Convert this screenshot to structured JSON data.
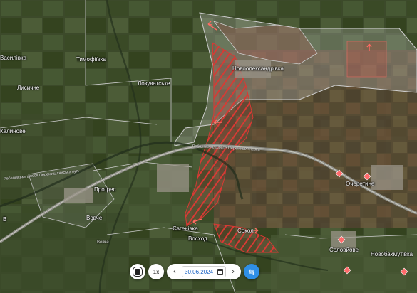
{
  "map": {
    "places": [
      {
        "id": "vasylivka",
        "label": "Василівка"
      },
      {
        "id": "tymofiivka",
        "label": "Тимофіївка"
      },
      {
        "id": "lysychne",
        "label": "Лисичне"
      },
      {
        "id": "lozuvatske",
        "label": "Лозуватське"
      },
      {
        "id": "novooleksandrivka",
        "label": "Новоолександрівка"
      },
      {
        "id": "sokil",
        "label": "Сокол"
      },
      {
        "id": "ocheretyne",
        "label": "Очеретине"
      },
      {
        "id": "prohres",
        "label": "Прогрес"
      },
      {
        "id": "vovche",
        "label": "Вовче"
      },
      {
        "id": "yevhenivka",
        "label": "Євгенівка"
      },
      {
        "id": "voskhod",
        "label": "Восход"
      },
      {
        "id": "solovyove",
        "label": "Соловйове"
      },
      {
        "id": "novobakhmutivka",
        "label": "Новобахмутівка"
      },
      {
        "id": "kalynove",
        "label": "Калинове"
      },
      {
        "id": "vovche2",
        "label": "Вовче"
      },
      {
        "id": "v-left",
        "label": "В"
      }
    ],
    "roads": [
      {
        "id": "road-left",
        "label": "Ребалівське шоссе Перемишлянська вул."
      },
      {
        "id": "road-right",
        "label": "Ребалівське шоссе Перемишлянська"
      }
    ],
    "colors": {
      "occupied_hatch": "#d83a34",
      "occupied_fill": "rgba(160,90,80,0.35)",
      "grey_zone": "rgba(200,200,200,0.30)",
      "boundary": "#cfcfcf",
      "attack_arrow": "#ff6a62",
      "marker": "#ff6b6b"
    }
  },
  "controls": {
    "play_icon": "record-icon",
    "speed_label": "1x",
    "date_prev_icon": "chevron-left-icon",
    "date_value": "30.06.2024",
    "date_next_icon": "chevron-right-icon",
    "sync_icon": "swap-icon"
  }
}
